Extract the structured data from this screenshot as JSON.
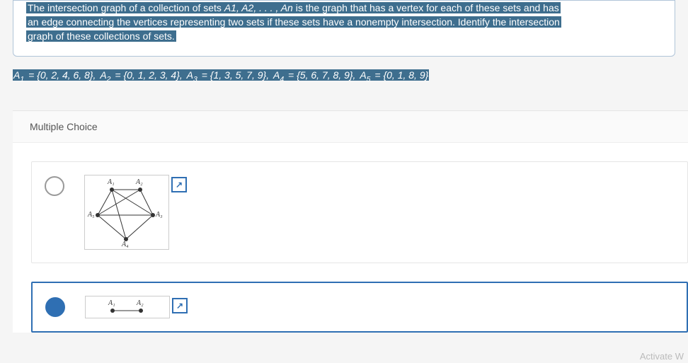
{
  "prompt": {
    "line1_pre": "The intersection graph of a collection of sets ",
    "sets_symbol": "A1, A2, . . . , An",
    "line1_post": " is the graph that has a vertex for each of these sets and has",
    "line2": "an edge connecting the vertices representing two sets if these sets have a nonempty intersection. Identify the intersection",
    "line3": "graph of these collections of sets."
  },
  "sets_line": {
    "a1_lhs": "A1",
    "a1_rhs": " = {0, 2, 4, 6, 8}, ",
    "a2_lhs": "A2",
    "a2_rhs": " = {0, 1, 2, 3, 4}, ",
    "a3_lhs": "A3",
    "a3_rhs": " = {1, 3, 5, 7, 9}, ",
    "a4_lhs": "A4",
    "a4_rhs": " = {5, 6, 7, 8, 9}, ",
    "a5_lhs": "A5",
    "a5_rhs": " = {0, 1, 8, 9}"
  },
  "mc_header": "Multiple Choice",
  "graph": {
    "labels": {
      "v1": "A₁",
      "v2": "A₂",
      "v3": "A₃",
      "v4": "A₄",
      "v5": "A₅"
    }
  },
  "expand_icon_glyph": "↗",
  "watermark": "Activate W"
}
